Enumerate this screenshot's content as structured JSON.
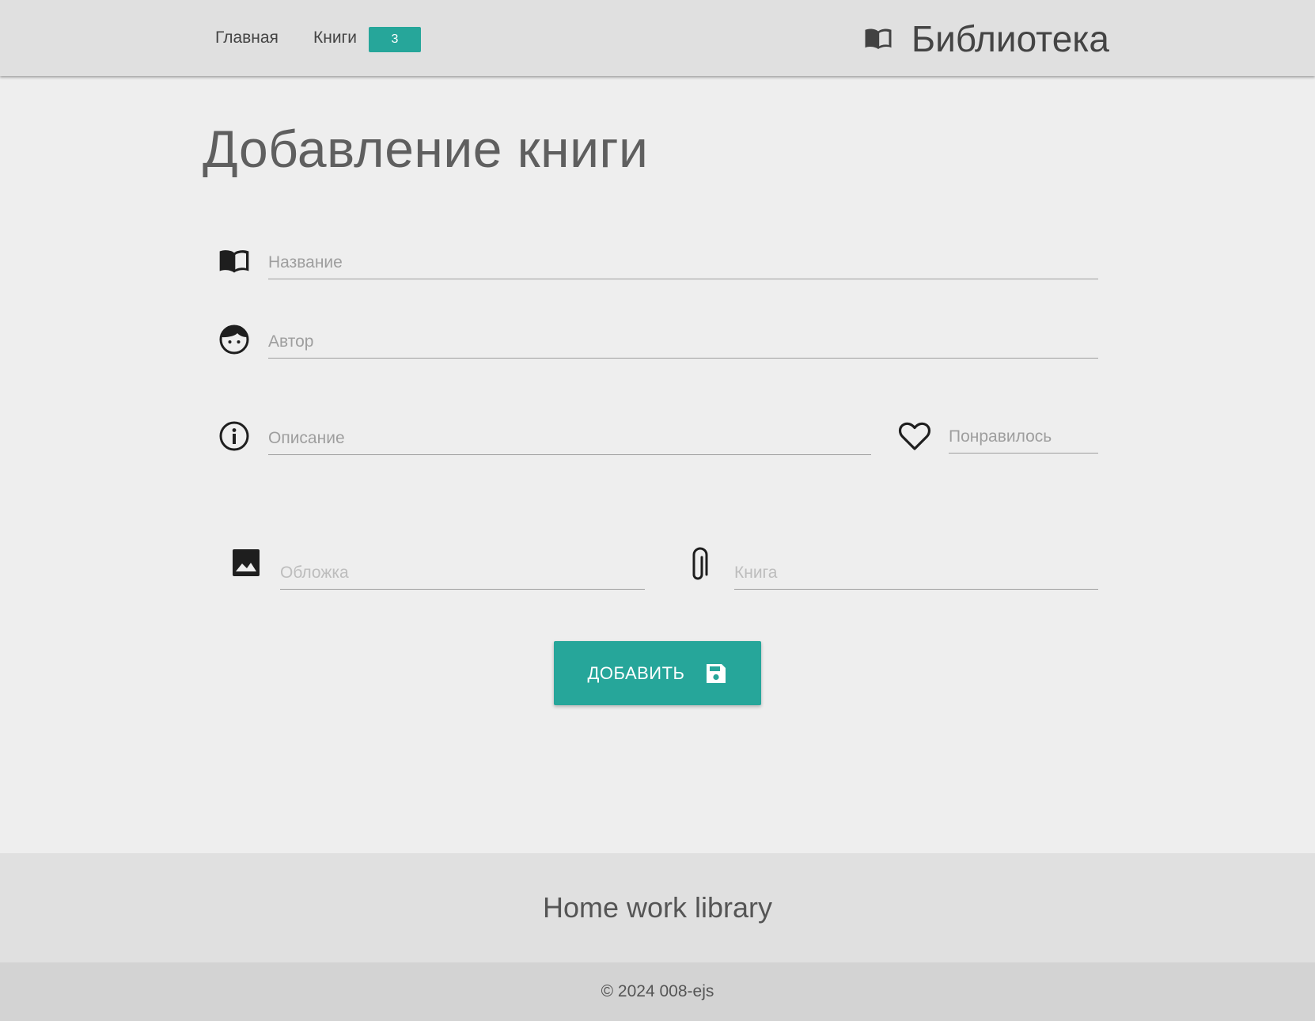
{
  "nav": {
    "home_label": "Главная",
    "books_label": "Книги",
    "books_count": "3",
    "brand": "Библиотека",
    "brand_icon": "book-open-icon"
  },
  "page": {
    "title": "Добавление книги"
  },
  "form": {
    "title": {
      "placeholder": "Название",
      "value": "",
      "icon": "book-open-icon"
    },
    "author": {
      "placeholder": "Автор",
      "value": "",
      "icon": "face-icon"
    },
    "description": {
      "placeholder": "Описание",
      "value": "",
      "icon": "info-icon"
    },
    "favorite": {
      "placeholder": "Понравилось",
      "value": "",
      "icon": "heart-icon"
    },
    "cover": {
      "placeholder": "Обложка",
      "value": "",
      "icon": "image-icon"
    },
    "book_file": {
      "placeholder": "Книга",
      "value": "",
      "icon": "paperclip-icon"
    },
    "submit_label": "ДОБАВИТЬ",
    "submit_icon": "save-icon"
  },
  "footer": {
    "title": "Home work library",
    "copyright": "© 2024 008-ejs"
  },
  "colors": {
    "accent": "#26a69a",
    "navbar_bg": "#e0e0e0",
    "page_bg": "#eeeeee",
    "copyright_bg": "#d3d3d3"
  }
}
